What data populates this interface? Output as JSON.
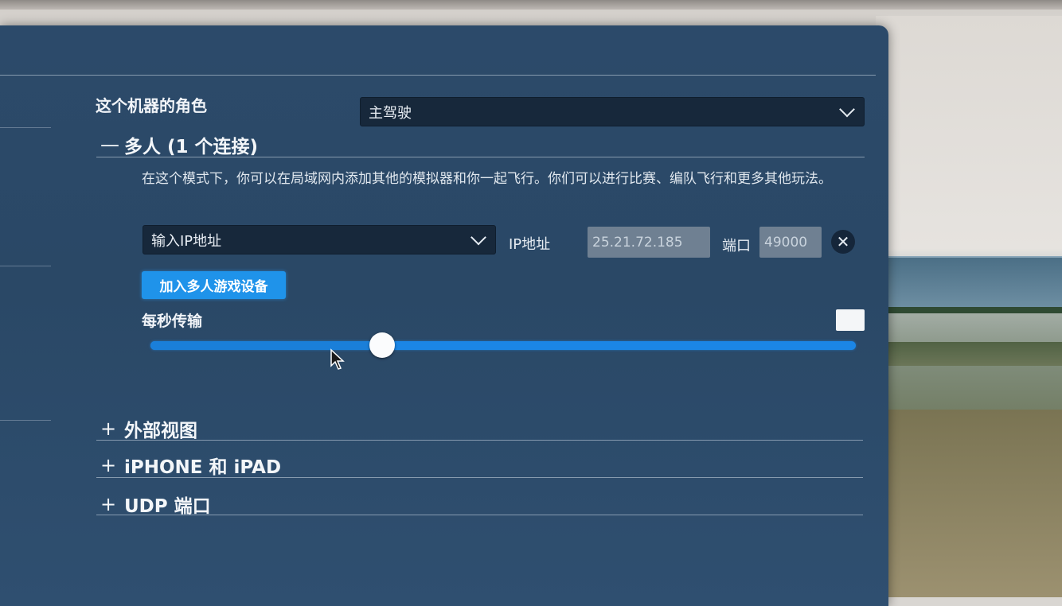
{
  "role": {
    "label": "这个机器的角色",
    "selected": "主驾驶"
  },
  "multiplayer": {
    "title": "多人 (1 个连接)",
    "expanded": true,
    "description": "在这个模式下，你可以在局域网内添加其他的模拟器和你一起飞行。你们可以进行比赛、编队飞行和更多其他玩法。",
    "ip_select_value": "输入IP地址",
    "ip_label": "IP地址",
    "ip_value": "25.21.72.185",
    "port_label": "端口",
    "port_value": "49000",
    "close_icon": "close-icon",
    "add_button": "加入多人游戏设备"
  },
  "rate": {
    "label": "每秒传输",
    "value": "",
    "slider_fraction": 0.328
  },
  "sections": [
    {
      "title": "外部视图",
      "expanded": false
    },
    {
      "title": "iPHONE 和 iPAD",
      "expanded": false
    },
    {
      "title": "UDP 端口",
      "expanded": false
    }
  ],
  "colors": {
    "panel": "#2c4a6a",
    "accent": "#1f93ea",
    "dropdown": "#17283b"
  }
}
